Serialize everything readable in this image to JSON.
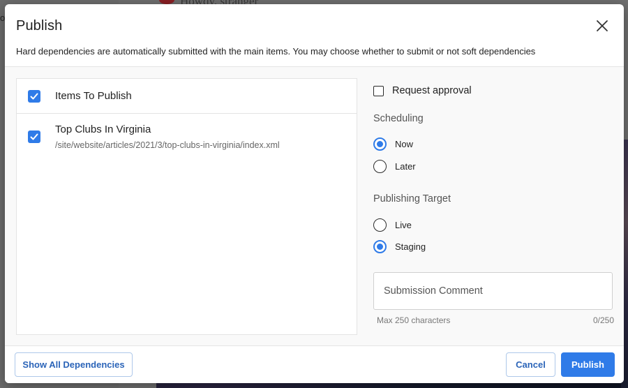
{
  "background": {
    "greeting": "Howdy, stranger",
    "edge_letter": "o"
  },
  "dialog": {
    "title": "Publish",
    "subtitle": "Hard dependencies are automatically submitted with the main items. You may choose whether to submit or not soft dependencies",
    "close_icon": "close-icon"
  },
  "items": {
    "header_label": "Items To Publish",
    "header_checked": true,
    "list": [
      {
        "title": "Top Clubs In Virginia",
        "path": "/site/website/articles/2021/3/top-clubs-in-virginia/index.xml",
        "checked": true
      }
    ]
  },
  "options": {
    "request_approval": {
      "label": "Request approval",
      "checked": false
    },
    "scheduling": {
      "label": "Scheduling",
      "options": [
        {
          "label": "Now",
          "selected": true
        },
        {
          "label": "Later",
          "selected": false
        }
      ]
    },
    "publishing_target": {
      "label": "Publishing Target",
      "options": [
        {
          "label": "Live",
          "selected": false
        },
        {
          "label": "Staging",
          "selected": true
        }
      ]
    },
    "comment": {
      "placeholder": "Submission Comment",
      "value": "",
      "helper": "Max 250 characters",
      "counter": "0/250"
    }
  },
  "footer": {
    "show_deps_label": "Show All Dependencies",
    "cancel_label": "Cancel",
    "publish_label": "Publish"
  },
  "colors": {
    "accent": "#2f7be8",
    "outline_button_text": "#2b64b8",
    "overlay": "#6f6f6f"
  }
}
